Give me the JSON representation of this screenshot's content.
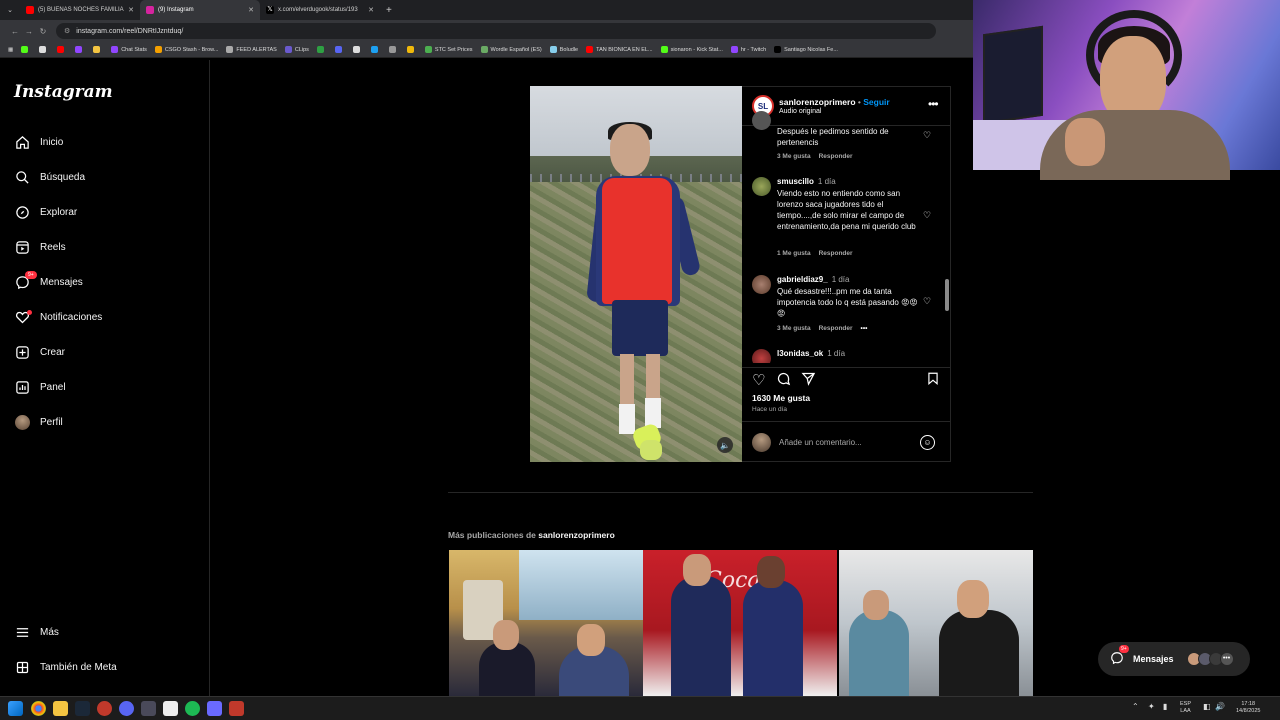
{
  "browser": {
    "tabs": [
      {
        "title": "(5) BUENAS NOCHES FAMILIA",
        "color": "#ff0000",
        "active": false
      },
      {
        "title": "(9) Instagram",
        "color": "#d6249f",
        "active": true
      },
      {
        "title": "x.com/elverdugook/status/193",
        "color": "#000000",
        "active": false
      }
    ],
    "url": "instagram.com/reel/DNRtIJzntduq/",
    "bookmarks": [
      "Chat Stats",
      "CSGO Stash - Brow...",
      "FEED ALERTAS",
      "CLips",
      "STC Set Prices",
      "Wordle Español (ES)",
      "Boludle",
      "TAN BIONICA EN EL...",
      "sionaron - Kick Stat...",
      "hr - Twitch",
      "Santiago Nicolas Fe..."
    ]
  },
  "sidebar": {
    "logo": "Instagram",
    "items": [
      {
        "label": "Inicio",
        "icon": "home-icon"
      },
      {
        "label": "Búsqueda",
        "icon": "search-icon"
      },
      {
        "label": "Explorar",
        "icon": "compass-icon"
      },
      {
        "label": "Reels",
        "icon": "reels-icon"
      },
      {
        "label": "Mensajes",
        "icon": "messenger-icon",
        "badge": "9+"
      },
      {
        "label": "Notificaciones",
        "icon": "heart-icon"
      },
      {
        "label": "Crear",
        "icon": "plus-square-icon"
      },
      {
        "label": "Panel",
        "icon": "chart-icon"
      },
      {
        "label": "Perfil",
        "icon": "avatar"
      }
    ],
    "bottom": [
      {
        "label": "Más",
        "icon": "menu-icon"
      },
      {
        "label": "También de Meta",
        "icon": "meta-icon"
      }
    ]
  },
  "post": {
    "username": "sanlorenzoprimero",
    "follow": "Seguir",
    "separator": "•",
    "audio": "Audio original",
    "avatar_text": "SL",
    "comments": [
      {
        "user": "",
        "time": "",
        "text": "Después le pedimos sentido de pertenencis",
        "likes": "3 Me gusta",
        "reply": "Responder",
        "avatar_color": "#555555"
      },
      {
        "user": "smuscillo",
        "time": "1 día",
        "text": "Viendo esto no entiendo como san lorenzo saca jugadores tido el tiempo....,de solo mirar el campo de entrenamiento,da pena mi querido club",
        "likes": "1 Me gusta",
        "reply": "Responder",
        "avatar_color": "#6b7a3a"
      },
      {
        "user": "gabrieldiaz9_",
        "time": "1 día",
        "text": "Qué desastre!!!..pm me da tanta impotencia todo lo q está pasando 😡😡😡",
        "likes": "3 Me gusta",
        "reply": "Responder",
        "avatar_color": "#7a5a4a"
      },
      {
        "user": "l3onidas_ok",
        "time": "1 día",
        "text": "",
        "likes": "",
        "reply": "",
        "avatar_color": "#8a2a2a"
      }
    ],
    "likes": "1630 Me gusta",
    "ago": "Hace un día",
    "add_comment_placeholder": "Añade un comentario..."
  },
  "more": {
    "prefix": "Más publicaciones de",
    "user": "sanlorenzoprimero"
  },
  "messages_pill": {
    "label": "Mensajes",
    "badge": "9+"
  },
  "taskbar": {
    "lang": "ESP",
    "lang2": "LAA",
    "time": "17:18",
    "date": "14/8/2025"
  },
  "colors": {
    "accent": "#0095f6",
    "notify": "#ff3040",
    "bg": "#000000"
  }
}
